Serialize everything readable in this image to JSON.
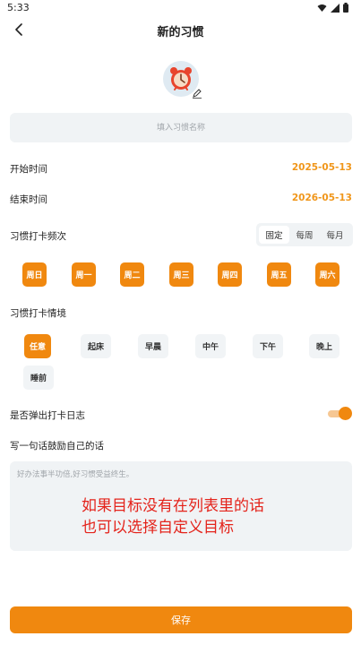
{
  "status_bar": {
    "time": "5:33"
  },
  "header": {
    "title": "新的习惯"
  },
  "habit": {
    "icon": "alarm-clock-icon",
    "name_placeholder": "填入习惯名称"
  },
  "start": {
    "label": "开始时间",
    "value": "2025-05-13"
  },
  "end": {
    "label": "结束时间",
    "value": "2026-05-13"
  },
  "frequency": {
    "label": "习惯打卡频次",
    "options": [
      "固定",
      "每周",
      "每月"
    ],
    "selected": "固定",
    "days": [
      "周日",
      "周一",
      "周二",
      "周三",
      "周四",
      "周五",
      "周六"
    ]
  },
  "scenario": {
    "label": "习惯打卡情境",
    "options": [
      "任意",
      "起床",
      "早晨",
      "中午",
      "下午",
      "晚上",
      "睡前"
    ],
    "selected": "任意"
  },
  "popup_log": {
    "label": "是否弹出打卡日志",
    "enabled": true
  },
  "motto": {
    "label": "写一句话鼓励自己的话",
    "placeholder": "好办法事半功倍,好习惯受益终生。",
    "overlay_line1": "如果目标没有在列表里的话",
    "overlay_line2": "也可以选择自定义目标"
  },
  "save_label": "保存",
  "colors": {
    "accent": "#f0880f",
    "value_text": "#f0961a",
    "field_bg": "#f0f3f5",
    "overlay_text": "#e4231b"
  }
}
